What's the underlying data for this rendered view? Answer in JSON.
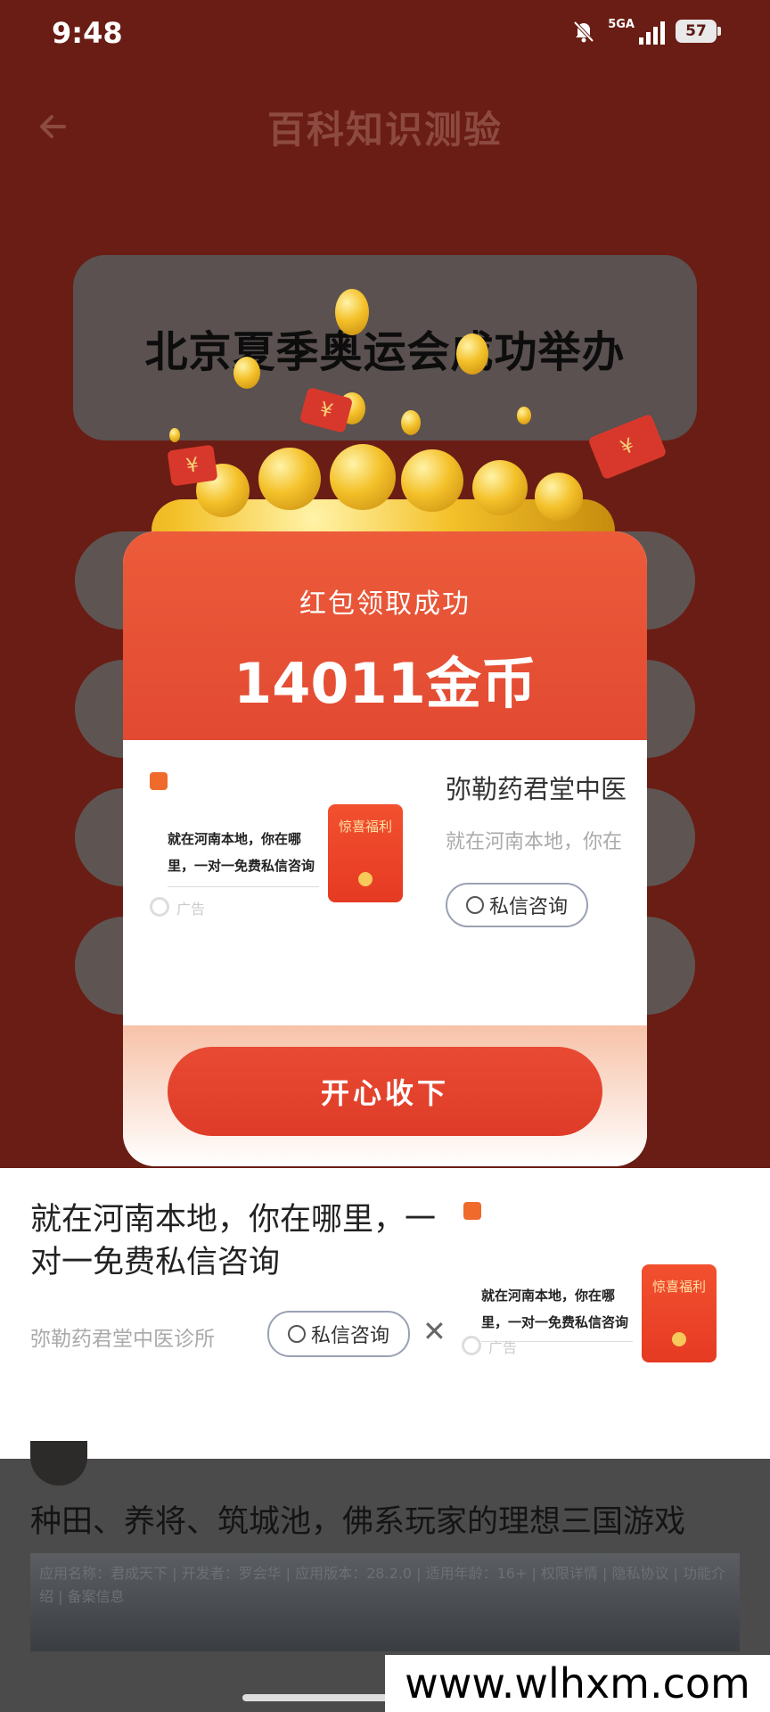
{
  "status": {
    "time": "9:48",
    "network": "5GA",
    "battery": "57"
  },
  "header": {
    "title": "百科知识测验"
  },
  "quiz": {
    "question": "北京夏季奥运会成功举办"
  },
  "popup": {
    "subtitle": "红包领取成功",
    "amount": "14011金币",
    "ad": {
      "thumb_text": "就在河南本地，你在哪里，一对一免费私信咨询",
      "thumb_packet": "惊喜福利",
      "thumb_tag": "广告",
      "name": "弥勒药君堂中医",
      "desc": "就在河南本地，你在",
      "chat_label": "私信咨询"
    },
    "ok_label": "开心收下"
  },
  "banner": {
    "headline": "就在河南本地，你在哪里，一对一免费私信咨询",
    "advertiser": "弥勒药君堂中医诊所",
    "chat_label": "私信咨询",
    "close_label": "✕",
    "thumb_text": "就在河南本地，你在哪里，一对一免费私信咨询",
    "thumb_packet": "惊喜福利",
    "thumb_tag": "广告"
  },
  "feed": {
    "title": "种田、养将、筑城池，佛系玩家的理想三国游戏",
    "meta": "应用名称：君成天下 | 开发者：罗会华 | 应用版本：28.2.0 | 适用年龄：16+ | 权限详情 | 隐私协议 | 功能介绍 | 备案信息"
  },
  "watermark": "www.wlhxm.com"
}
